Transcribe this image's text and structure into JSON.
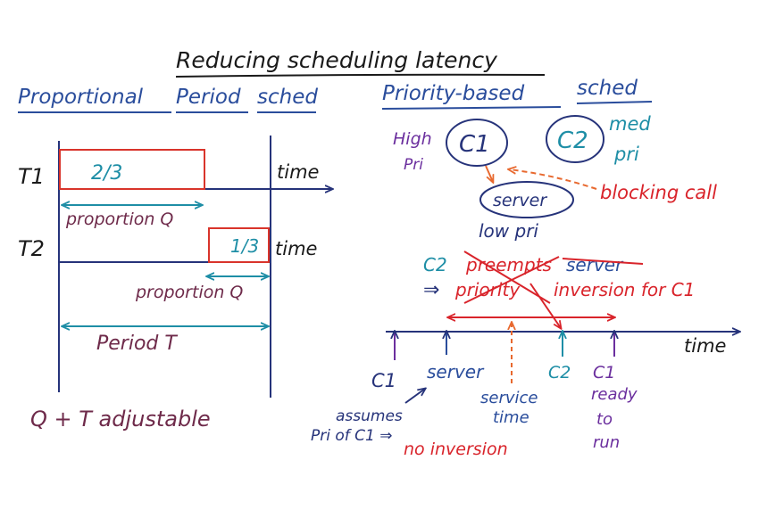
{
  "title": "Reducing scheduling latency",
  "colors": {
    "ink": "#1a1a1a",
    "navy": "#26337a",
    "blue": "#2a4d9c",
    "teal": "#1e8ea6",
    "maroon": "#6e2a4a",
    "red": "#d9242b",
    "orange": "#e8692f",
    "purple": "#6b2f9e",
    "box_red": "#d9342b"
  },
  "left": {
    "heading_proportional": "Proportional",
    "heading_period": "Period",
    "heading_sched": "sched",
    "t1_label": "T1",
    "t2_label": "T2",
    "t1_fraction": "2/3",
    "t2_fraction": "1/3",
    "time_label_1": "time",
    "time_label_2": "time",
    "proportion_q_1": "proportion Q",
    "proportion_q_2": "proportion Q",
    "period_t": "Period T",
    "note": "Q + T adjustable"
  },
  "right": {
    "heading_priority": "Priority-based",
    "heading_sched": "sched",
    "high_pri_1": "High",
    "high_pri_2": "Pri",
    "c1_node": "C1",
    "c2_node": "C2",
    "med_pri_1": "med",
    "med_pri_2": "pri",
    "server_node": "server",
    "low_pri": "low pri",
    "blocking_call": "blocking call",
    "c2_prefix": "C2",
    "struck_preempts": "preempts",
    "server_word": "server",
    "implies": "⇒",
    "struck_priority": "priority",
    "inversion_text": "inversion for C1",
    "time_axis": "time",
    "ev_c1": "C1",
    "ev_server": "server",
    "ev_service_1": "service",
    "ev_service_2": "time",
    "ev_c2": "C2",
    "ev_c1_ready_1": "C1",
    "ev_c1_ready_2": "ready",
    "ev_c1_ready_3": "to",
    "ev_c1_ready_4": "run",
    "assumes_1": "assumes",
    "assumes_2": "Pri of C1 ⇒",
    "no_inversion": "no inversion"
  }
}
